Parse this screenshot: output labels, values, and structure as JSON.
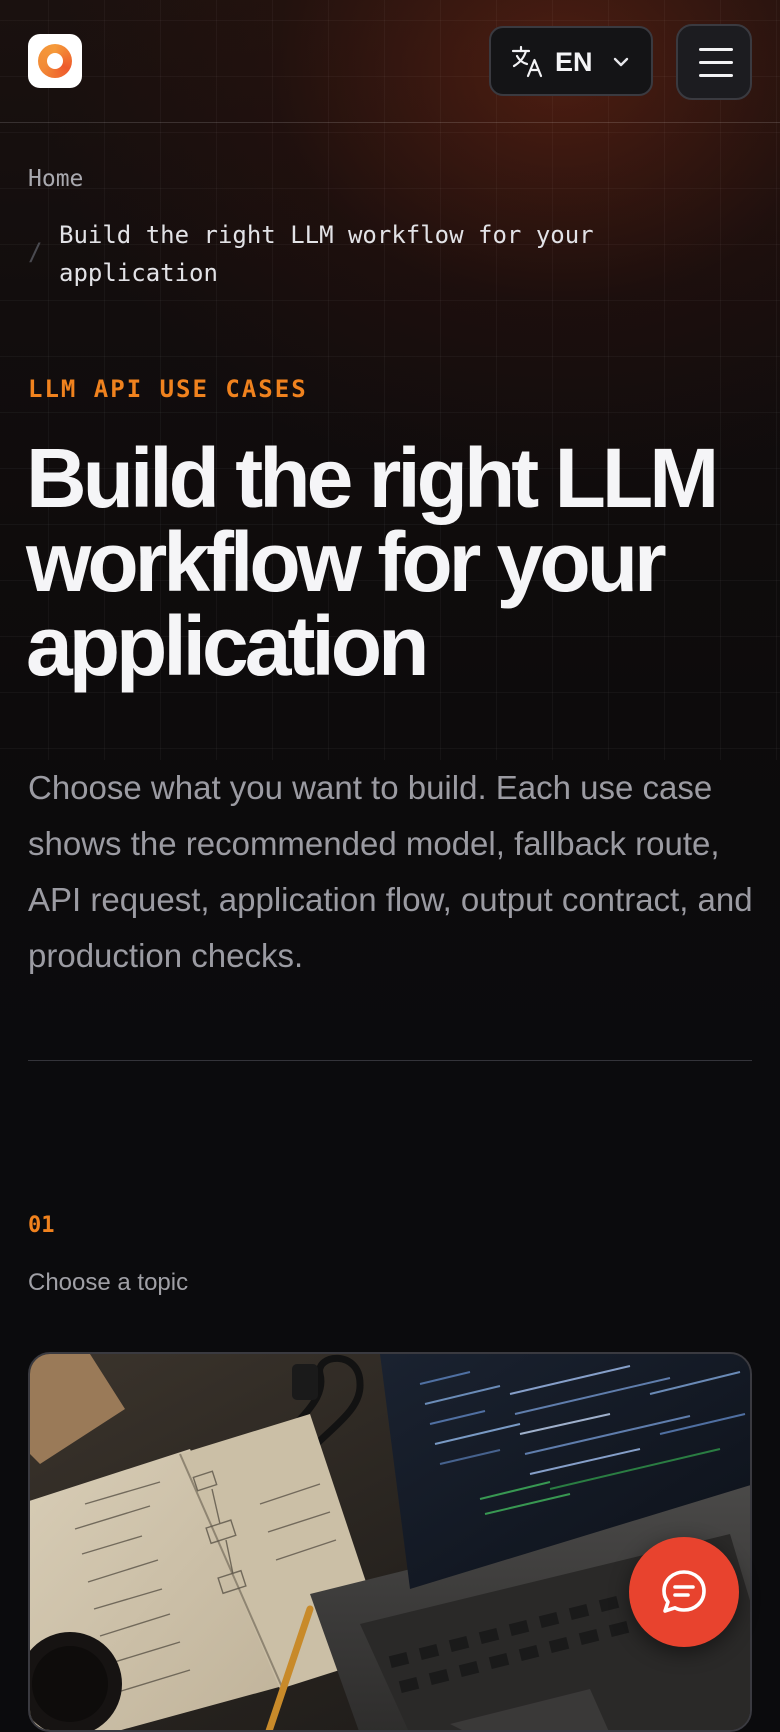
{
  "header": {
    "logo_alt": "logo",
    "language": {
      "selected": "EN"
    }
  },
  "breadcrumb": {
    "home": "Home",
    "separator": "/",
    "current": "Build the right LLM workflow for your application"
  },
  "hero": {
    "eyebrow": "LLM API USE CASES",
    "title": "Build the right LLM workflow for your application",
    "description": "Choose what you want to build. Each use case shows the recommended model, fallback route, API request, application flow, output contract, and production checks."
  },
  "step": {
    "number": "01",
    "label": "Choose a topic"
  },
  "colors": {
    "accent": "#f0821e",
    "chat_button": "#e8432e",
    "background": "#0b0b0d"
  },
  "icons": {
    "language": "translate-icon",
    "chevron": "chevron-down-icon",
    "menu": "hamburger-menu-icon",
    "chat": "chat-bubble-icon"
  }
}
